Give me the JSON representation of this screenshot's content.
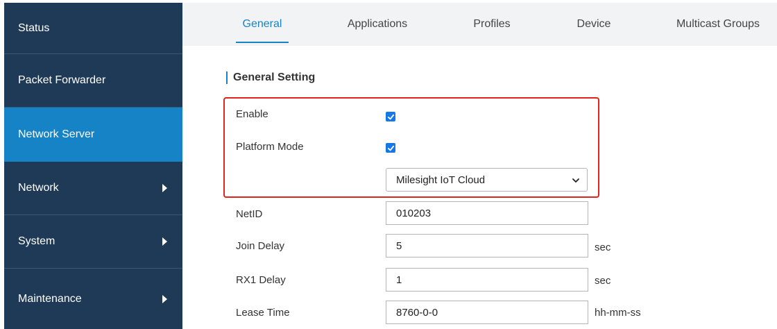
{
  "sidebar": {
    "items": [
      {
        "label": "Status",
        "has_arrow": false
      },
      {
        "label": "Packet Forwarder",
        "has_arrow": false
      },
      {
        "label": "Network Server",
        "has_arrow": false,
        "active": true
      },
      {
        "label": "Network",
        "has_arrow": true
      },
      {
        "label": "System",
        "has_arrow": true
      },
      {
        "label": "Maintenance",
        "has_arrow": true
      }
    ]
  },
  "tabs": [
    {
      "label": "General",
      "active": true
    },
    {
      "label": "Applications"
    },
    {
      "label": "Profiles"
    },
    {
      "label": "Device"
    },
    {
      "label": "Multicast Groups"
    }
  ],
  "section": {
    "title": "General Setting"
  },
  "form": {
    "enable": {
      "label": "Enable",
      "checked": true
    },
    "platform_mode": {
      "label": "Platform Mode",
      "checked": true,
      "selected": "Milesight IoT Cloud"
    },
    "netid": {
      "label": "NetID",
      "value": "010203"
    },
    "join_delay": {
      "label": "Join Delay",
      "value": "5",
      "unit": "sec"
    },
    "rx1_delay": {
      "label": "RX1 Delay",
      "value": "1",
      "unit": "sec"
    },
    "lease_time": {
      "label": "Lease Time",
      "value": "8760-0-0",
      "unit": "hh-mm-ss"
    }
  },
  "colors": {
    "sidebar_bg": "#1f3a57",
    "sidebar_active": "#1683c7",
    "accent": "#1683c7",
    "checkbox": "#1677e6",
    "highlight_border": "#e0231b"
  },
  "icons": {
    "checkbox": "check-icon",
    "select": "chevron-down-icon",
    "submenu": "caret-right-icon"
  }
}
